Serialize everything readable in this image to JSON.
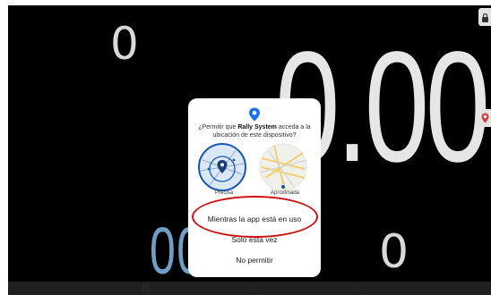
{
  "speedometer": {
    "main_readout": "0.00",
    "top_left_value": "0",
    "bottom_left_value": "00",
    "bottom_right_value": "0"
  },
  "dialog": {
    "title_prefix": "¿Permitir que ",
    "app_name": "Rally System",
    "title_suffix": " acceda a la ubicación de este dispositivo?",
    "option_precise_label": "Precisa",
    "option_approx_label": "Aproximada",
    "buttons": {
      "while_using": "Mientras la app está en uso",
      "only_this_time": "Solo esta vez",
      "deny": "No permitir"
    }
  },
  "icons": {
    "top_right": "lock-icon",
    "right_edge": "location-icon",
    "dialog_header": "location-pin-icon"
  },
  "colors": {
    "background": "#000000",
    "accent_blue": "#1a73e8",
    "readout_blue": "#6f9ec6",
    "annotation_red": "#d10f0f"
  }
}
